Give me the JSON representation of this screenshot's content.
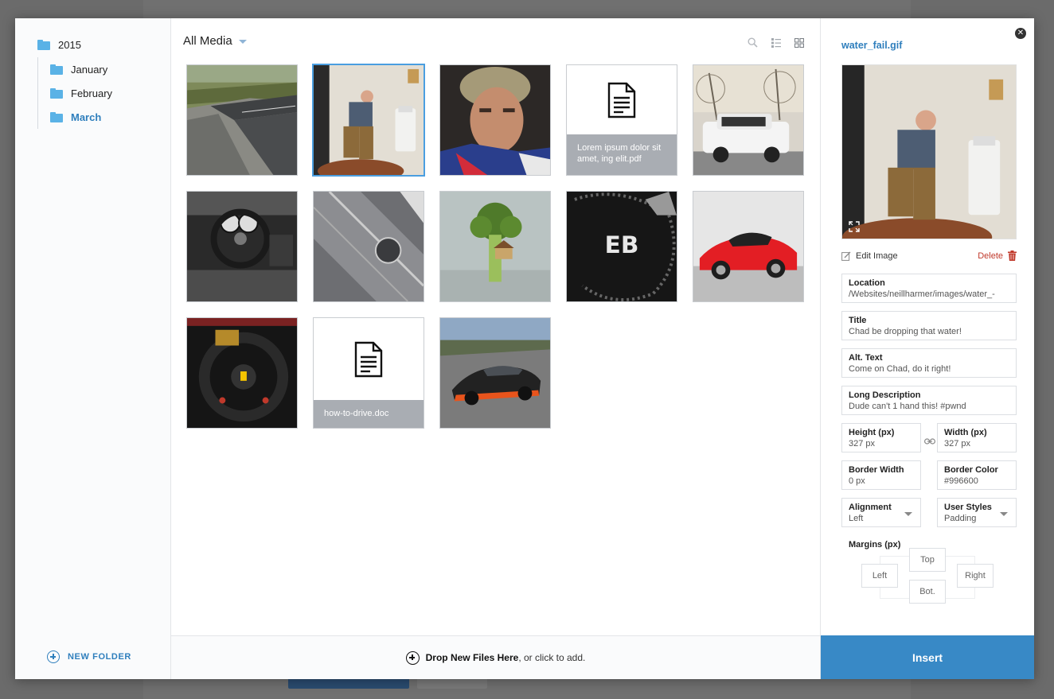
{
  "sidebar": {
    "root": "2015",
    "folders": [
      {
        "label": "January"
      },
      {
        "label": "February"
      },
      {
        "label": "March"
      }
    ],
    "new_folder_label": "NEW FOLDER"
  },
  "toolbar": {
    "filter_label": "All Media"
  },
  "media": [
    {
      "kind": "image",
      "subject": "runway-aerial"
    },
    {
      "kind": "image",
      "subject": "man-water-cooler"
    },
    {
      "kind": "image",
      "subject": "portrait"
    },
    {
      "kind": "file",
      "caption": "Lorem ipsum dolor sit amet, ing elit.pdf"
    },
    {
      "kind": "image",
      "subject": "white-suv"
    },
    {
      "kind": "image",
      "subject": "car-dashboard"
    },
    {
      "kind": "image",
      "subject": "engine-cover"
    },
    {
      "kind": "image",
      "subject": "broccoli-treehouse"
    },
    {
      "kind": "image",
      "subject": "bugatti-keychain"
    },
    {
      "kind": "image",
      "subject": "red-sports-car"
    },
    {
      "kind": "image",
      "subject": "ferrari-steering-wheel"
    },
    {
      "kind": "file",
      "caption": "how-to-drive.doc"
    },
    {
      "kind": "image",
      "subject": "bugatti-track"
    }
  ],
  "dropzone": {
    "bold": "Drop New Files Here",
    "rest": ", or click to add."
  },
  "details": {
    "file_name": "water_fail.gif",
    "edit_label": "Edit Image",
    "delete_label": "Delete",
    "location": {
      "label": "Location",
      "value": "/Websites/neillharmer/images/water_-"
    },
    "title": {
      "label": "Title",
      "value": "Chad be dropping that water!"
    },
    "alt": {
      "label": "Alt. Text",
      "value": "Come on Chad, do it right!"
    },
    "long_desc": {
      "label": "Long Description",
      "value": "Dude can't 1 hand this! #pwnd"
    },
    "height": {
      "label": "Height (px)",
      "value": "327 px"
    },
    "width": {
      "label": "Width (px)",
      "value": "327 px"
    },
    "border_width": {
      "label": "Border Width",
      "value": "0 px"
    },
    "border_color": {
      "label": "Border Color",
      "value": "#996600"
    },
    "alignment": {
      "label": "Alignment",
      "value": "Left"
    },
    "user_styles": {
      "label": "User Styles",
      "value": "Padding"
    },
    "margins": {
      "label": "Margins (px)",
      "top": "Top",
      "left": "Left",
      "right": "Right",
      "bottom": "Bot."
    },
    "insert_label": "Insert"
  },
  "colors": {
    "accent": "#3889c6",
    "folder": "#5ab2e6",
    "link": "#2f7fbd",
    "delete": "#c0392b"
  }
}
